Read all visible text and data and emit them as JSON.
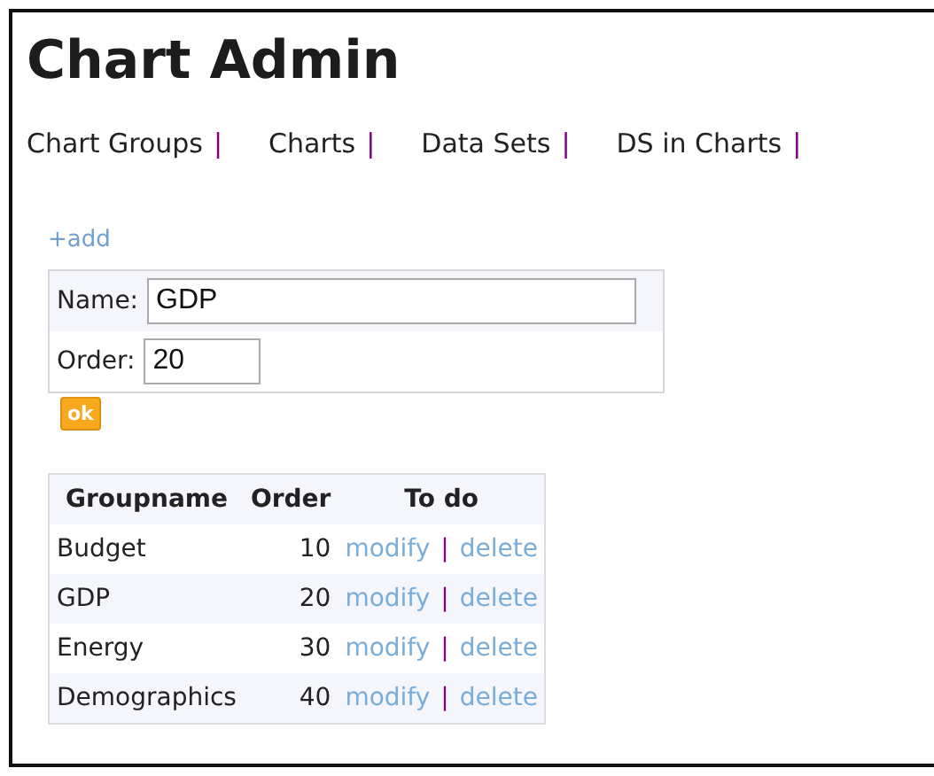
{
  "title": "Chart Admin",
  "nav": [
    {
      "label": "Chart Groups",
      "separator": "|"
    },
    {
      "label": "Charts",
      "separator": "|"
    },
    {
      "label": "Data Sets",
      "separator": "|"
    },
    {
      "label": "DS in Charts",
      "separator": "|"
    }
  ],
  "add_link": "+add",
  "form": {
    "fields": [
      {
        "label": "Name:",
        "value": "GDP",
        "kind": "wide"
      },
      {
        "label": "Order:",
        "value": "20",
        "kind": "short"
      }
    ],
    "submit": "ok"
  },
  "table": {
    "columns": [
      "Groupname",
      "Order",
      "To do"
    ],
    "rows": [
      {
        "name": "Budget",
        "order": "10",
        "modify": "modify",
        "separator": "|",
        "delete": "delete"
      },
      {
        "name": "GDP",
        "order": "20",
        "modify": "modify",
        "separator": "|",
        "delete": "delete"
      },
      {
        "name": "Energy",
        "order": "30",
        "modify": "modify",
        "separator": "|",
        "delete": "delete"
      },
      {
        "name": "Demographics",
        "order": "40",
        "modify": "modify",
        "separator": "|",
        "delete": "delete"
      }
    ]
  }
}
